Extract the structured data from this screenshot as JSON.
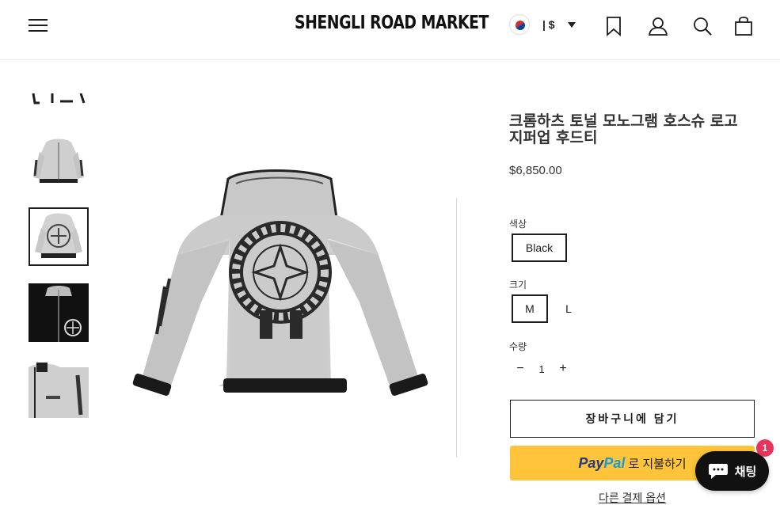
{
  "header": {
    "brand": "SHENGLI ROAD MARKET",
    "locale": "| $",
    "icons": [
      "hamburger-menu-icon",
      "korea-flag-icon",
      "caret-down-icon",
      "bookmark-icon",
      "account-icon",
      "search-icon",
      "cart-icon"
    ]
  },
  "gallery": {
    "thumbnail_count": 5,
    "active_thumbnail": 2
  },
  "product": {
    "title": "크롬하츠 토널 모노그램 호스슈 로고 지퍼업 후드티",
    "price": "$6,850.00",
    "color_label": "색상",
    "color_options": [
      "Black"
    ],
    "color_selected": "Black",
    "size_label": "크기",
    "size_options": [
      "M",
      "L"
    ],
    "size_selected": "M",
    "quantity_label": "수량",
    "quantity_value": "1",
    "qty_minus": "−",
    "qty_plus": "+",
    "add_to_cart": "장바구니에 담기",
    "paypal_brand_1": "Pay",
    "paypal_brand_2": "Pal",
    "paypal_suffix": "로 지불하기",
    "more_payment": "다른 결제 옵션"
  },
  "chat": {
    "label": "채팅",
    "badge": "1"
  },
  "colors": {
    "text": "#1c1d1d",
    "paypal_yellow": "#ffc439",
    "paypal_dark_blue": "#253b80",
    "paypal_light_blue": "#179bd7",
    "chat_bg": "#111111",
    "badge_red": "#e6345b"
  }
}
